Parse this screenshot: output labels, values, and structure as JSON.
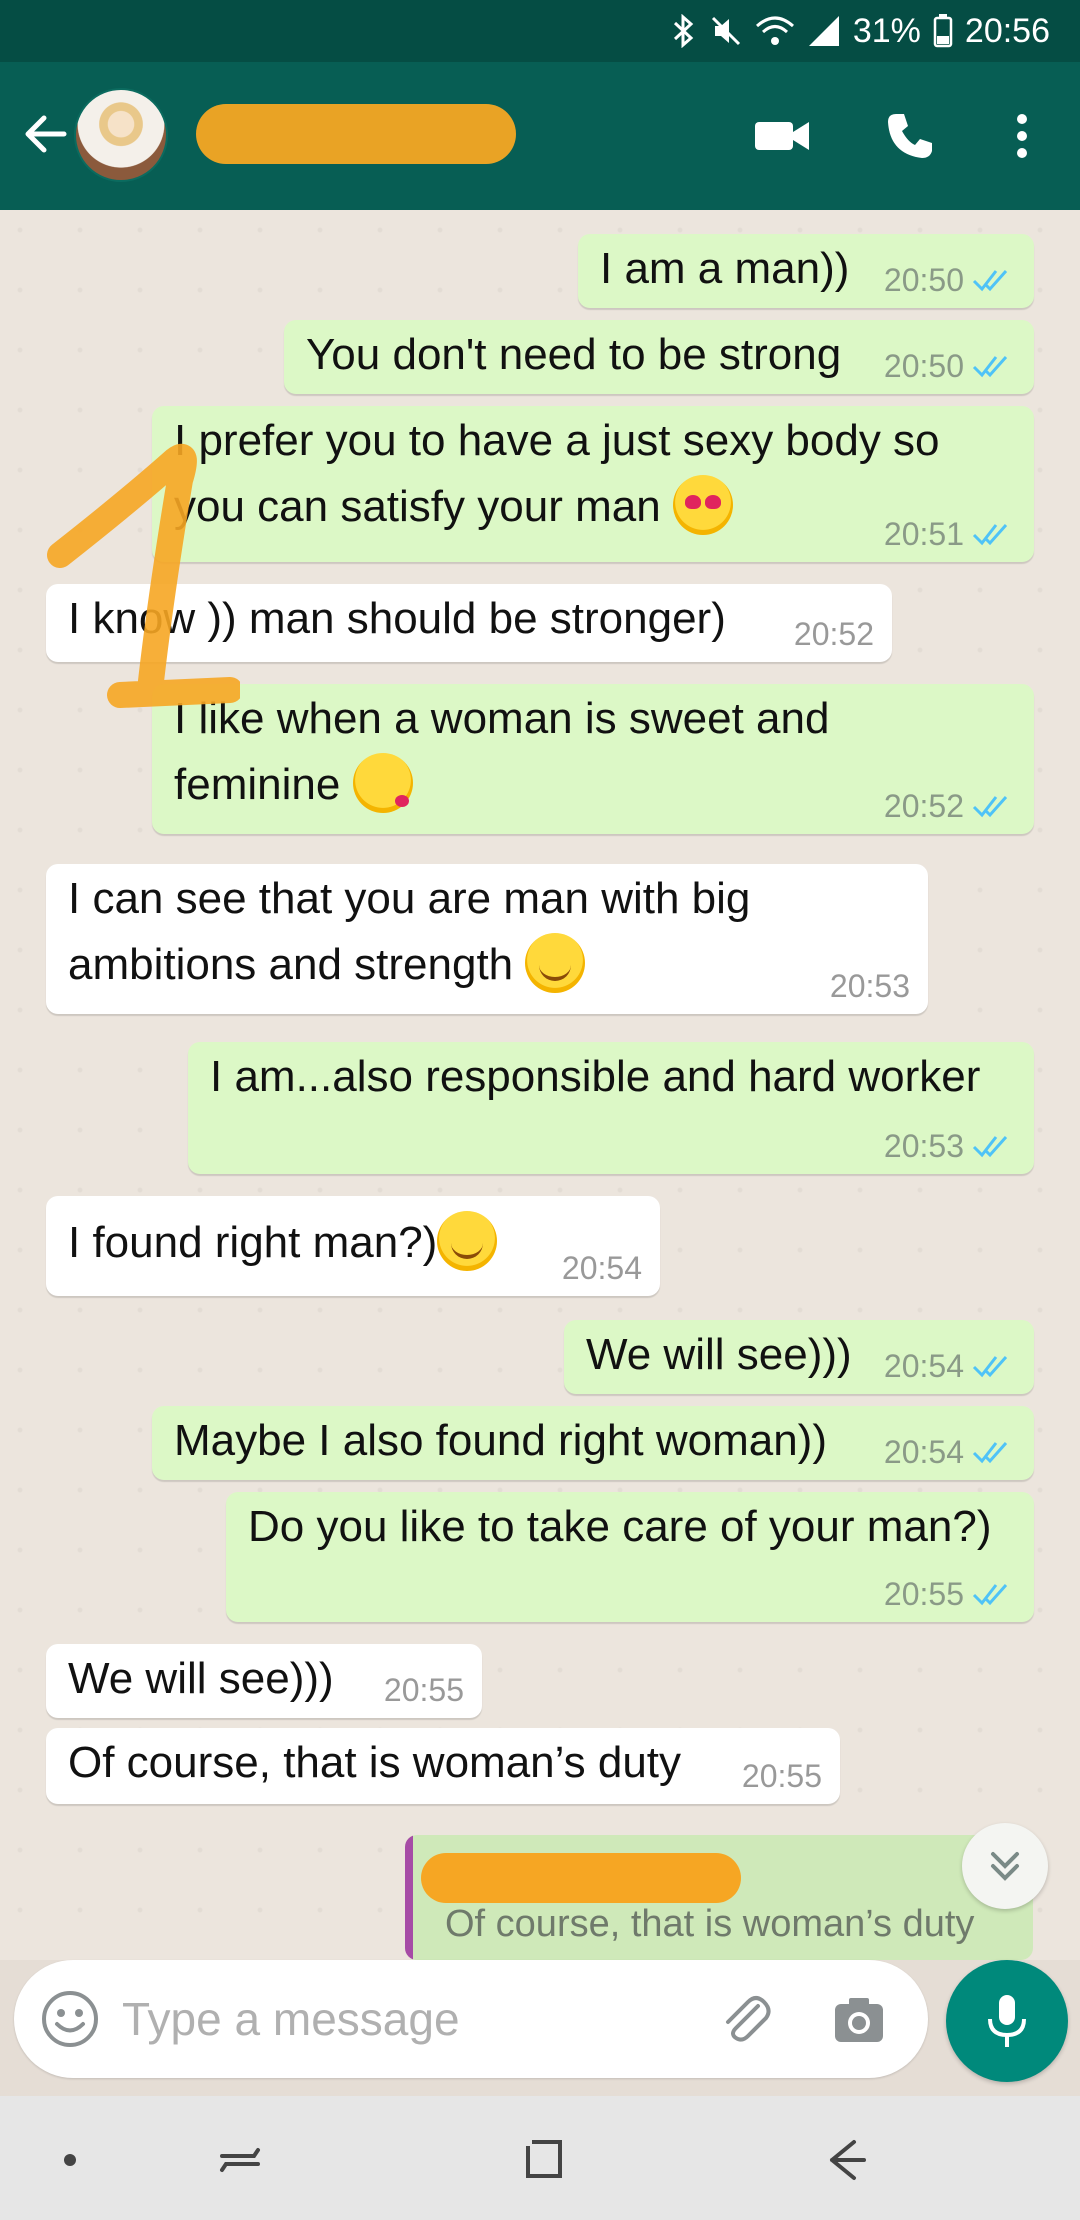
{
  "status_bar": {
    "battery": "31%",
    "time": "20:56",
    "icons": [
      "bluetooth-icon",
      "mute-icon",
      "wifi-icon",
      "signal-icon",
      "battery-icon"
    ]
  },
  "header": {
    "contact_name_redacted": "",
    "icons": [
      "back-arrow-icon",
      "video-call-icon",
      "phone-icon",
      "more-vert-icon"
    ],
    "accent_color": "#075e54"
  },
  "annotation": {
    "scribble": "1"
  },
  "messages": [
    {
      "dir": "out",
      "text": "I am a man))",
      "time": "20:50",
      "read": true,
      "emoji": null
    },
    {
      "dir": "out",
      "text": "You don't need to be strong",
      "time": "20:50",
      "read": true,
      "emoji": null
    },
    {
      "dir": "out",
      "text": "I prefer you to have a just sexy body so\nyou can satisfy your man",
      "time": "20:51",
      "read": true,
      "emoji": "heart-eyes-emoji"
    },
    {
      "dir": "in",
      "text": "I know )) man should be stronger)",
      "time": "20:52",
      "emoji": null
    },
    {
      "dir": "out",
      "text": "I like when a woman is sweet and\nfeminine",
      "time": "20:52",
      "read": true,
      "emoji": "kissing-emoji"
    },
    {
      "dir": "in",
      "text": "I can see that you are man with big\nambitions and strength",
      "time": "20:53",
      "emoji": "smiling-emoji"
    },
    {
      "dir": "out",
      "text": "I am...also responsible and hard worker",
      "time": "20:53",
      "read": true,
      "emoji": null
    },
    {
      "dir": "in",
      "text": "I found right man?)",
      "time": "20:54",
      "emoji": "blushing-emoji"
    },
    {
      "dir": "out",
      "text": "We will see)))",
      "time": "20:54",
      "read": true,
      "emoji": null
    },
    {
      "dir": "out",
      "text": "Maybe I also found right woman))",
      "time": "20:54",
      "read": true,
      "emoji": null
    },
    {
      "dir": "out",
      "text": "Do you like to take care of your man?)",
      "time": "20:55",
      "read": true,
      "emoji": null
    },
    {
      "dir": "in",
      "text": "We will see)))",
      "time": "20:55",
      "emoji": null
    },
    {
      "dir": "in",
      "text": "Of course, that is woman’s duty",
      "time": "20:55",
      "emoji": null
    }
  ],
  "reply_preview": {
    "quoted_text": "Of course, that is woman’s duty"
  },
  "composer": {
    "placeholder": "Type a message",
    "value": ""
  },
  "colors": {
    "outgoing_bubble": "#dcf8c6",
    "incoming_bubble": "#ffffff",
    "read_ticks": "#4fc3f7",
    "mic_button": "#00897b"
  }
}
